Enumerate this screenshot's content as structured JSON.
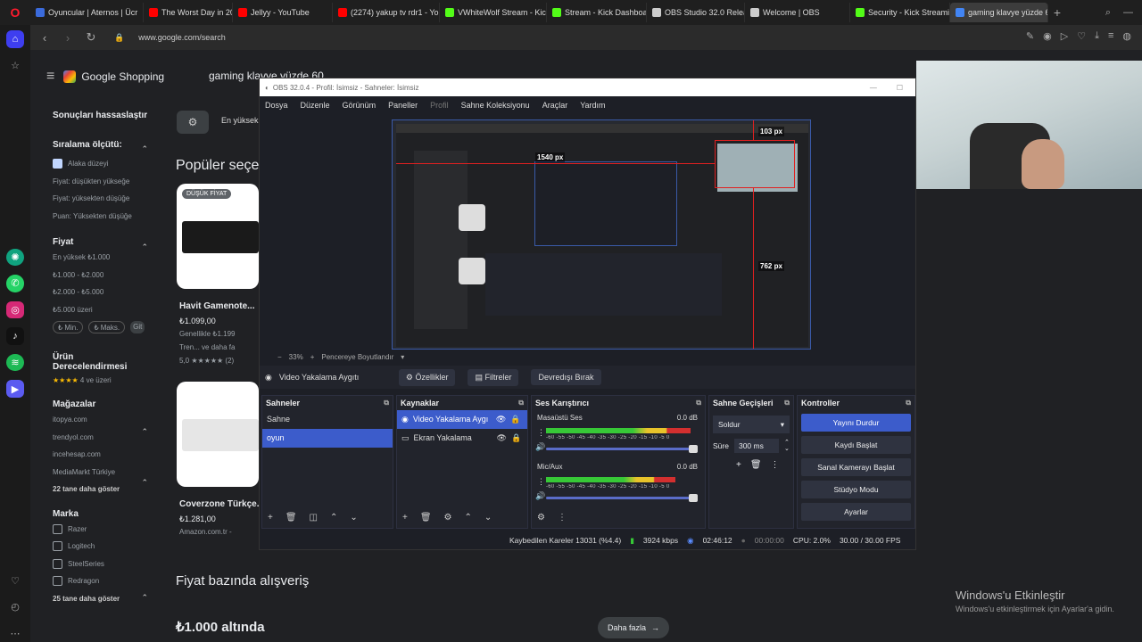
{
  "browser": {
    "tabs": [
      {
        "label": "Oyuncular | Aternos | Ücr",
        "color": "#3b6bdc"
      },
      {
        "label": "The Worst Day in 2016: A",
        "color": "#ff0000"
      },
      {
        "label": "Jellyy - YouTube",
        "color": "#ff0000"
      },
      {
        "label": "(2274) yakup tv rdr1 - Yo",
        "color": "#ff0000"
      },
      {
        "label": "VWhiteWolf Stream - Kick",
        "color": "#53fc18"
      },
      {
        "label": "Stream - Kick Dashboard",
        "color": "#53fc18"
      },
      {
        "label": "OBS Studio 32.0 Release",
        "color": "#cccccc"
      },
      {
        "label": "Welcome | OBS",
        "color": "#cccccc"
      },
      {
        "label": "Security - Kick Streaming",
        "color": "#53fc18"
      },
      {
        "label": "gaming klavye yüzde 60",
        "color": "#4285f4"
      }
    ],
    "url": "www.google.com/search"
  },
  "google": {
    "brand": "Google Shopping",
    "query": "gaming klavye yüzde 60",
    "filters_label": "Sonuçları hassaslaştır",
    "sort": {
      "title": "Sıralama ölçütü:",
      "items": [
        "Alaka düzeyi",
        "Fiyat: düşükten yükseğe",
        "Fiyat: yüksekten düşüğe",
        "Puan: Yüksekten düşüğe"
      ]
    },
    "price": {
      "title": "Fiyat",
      "items": [
        "En yüksek ₺1.000",
        "₺1.000 - ₺2.000",
        "₺2.000 - ₺5.000",
        "₺5.000 üzeri"
      ],
      "min": "₺ Min.",
      "max": "₺ Maks.",
      "go": "Git"
    },
    "rating": {
      "title": "Ürün Derecelendirmesi",
      "stars": "★★★★",
      "label": "4 ve üzeri"
    },
    "stores": {
      "title": "Mağazalar",
      "items": [
        "itopya.com",
        "trendyol.com",
        "incehesap.com",
        "MediaMarkt Türkiye"
      ],
      "more": "22 tane daha göster"
    },
    "brand_filter": {
      "title": "Marka",
      "items": [
        "Razer",
        "Logitech",
        "SteelSeries",
        "Redragon"
      ],
      "more": "25 tane daha göster"
    },
    "chip": "En yüksek",
    "popular_title": "Popüler seçe",
    "badge": "DÜŞÜK FİYAT",
    "product1": {
      "name": "Havit Gamenote...",
      "price": "₺1.099,00",
      "sub": "Genellikle ₺1.199",
      "store": "Tren... ve daha fa",
      "rating": "5,0 ★★★★★ (2)"
    },
    "product2": {
      "name": "Coverzone Türkçe...",
      "price": "₺1.281,00",
      "store": "Amazon.com.tr -"
    },
    "price_section": "Fiyat bazında alışveriş",
    "under": "₺1.000 altında",
    "more": "Daha fazla"
  },
  "obs": {
    "title": "OBS 32.0.4 - Profil: İsimsiz - Sahneler: İsimsiz",
    "menu": [
      "Dosya",
      "Düzenle",
      "Görünüm",
      "Paneller",
      "Profil",
      "Sahne Koleksiyonu",
      "Araçlar",
      "Yardım"
    ],
    "measures": {
      "top": "103 px",
      "left": "1540 px",
      "right": "762 px"
    },
    "zoom": "33%",
    "zoom_mode": "Pencereye Boyutlandır",
    "selected_source": "Video Yakalama Aygıtı",
    "properties": "Özellikler",
    "filters": "Filtreler",
    "deactivate": "Devredışı Bırak",
    "scenes": {
      "title": "Sahneler",
      "items": [
        "Sahne",
        "oyun"
      ]
    },
    "sources": {
      "title": "Kaynaklar",
      "items": [
        "Video Yakalama Aygı",
        "Ekran Yakalama"
      ]
    },
    "mixer": {
      "title": "Ses Karıştırıcı",
      "channels": [
        {
          "name": "Masaüstü Ses",
          "db": "0.0 dB",
          "level": 0.95
        },
        {
          "name": "Mic/Aux",
          "db": "0.0 dB",
          "level": 0.85
        }
      ],
      "ticks": "-60 -55 -50 -45 -40 -35 -30 -25 -20 -15 -10 -5 0"
    },
    "transitions": {
      "title": "Sahne Geçişleri",
      "type": "Soldur",
      "duration_label": "Süre",
      "duration": "300 ms"
    },
    "controls": {
      "title": "Kontroller",
      "buttons": [
        "Yayını Durdur",
        "Kaydı Başlat",
        "Sanal Kamerayı Başlat",
        "Stüdyo Modu",
        "Ayarlar"
      ]
    },
    "status": {
      "dropped": "Kaybedilen Kareler 13031 (%4.4)",
      "bitrate": "3924 kbps",
      "stream_time": "02:46:12",
      "rec_time": "00:00:00",
      "cpu": "CPU: 2.0%",
      "fps": "30.00 / 30.00 FPS"
    }
  },
  "windows": {
    "activate_title": "Windows'u Etkinleştir",
    "activate_sub": "Windows'u etkinleştirmek için Ayarlar'a gidin."
  }
}
